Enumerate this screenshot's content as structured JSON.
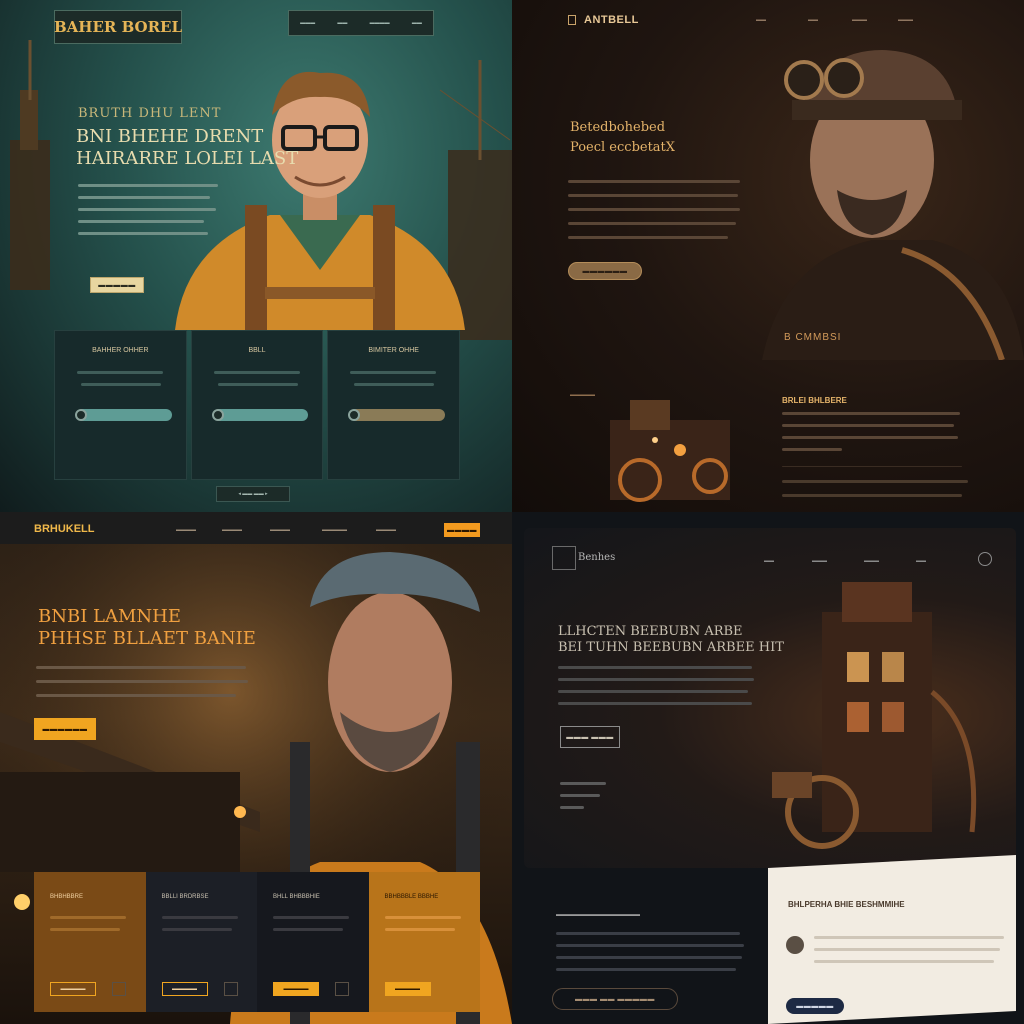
{
  "panel1": {
    "brand": "BAHER BOREL",
    "nav": [
      "▬▬▬",
      "▬▬",
      "▬▬▬▬",
      "▬▬"
    ],
    "kicker": "BRUTH DHU LENT",
    "headline": [
      "BNI BHEHE DRENT",
      "HAIRARRE LOLEI LAST"
    ],
    "cta_label": "▬▬▬▬▬",
    "cards": [
      {
        "title": "BAHHER OHHER"
      },
      {
        "title": "BBLL"
      },
      {
        "title": "BIMITER OHHE"
      }
    ],
    "pager_label": "◂ ▬▬ ▬▬ ▸",
    "colors": {
      "accent": "#e6b557",
      "teal_bar": "#5e9c95",
      "bronze_bar": "#8a7b57"
    }
  },
  "panel2": {
    "brand": "ANTBELL",
    "nav": [
      "▬▬",
      "▬▬",
      "▬▬▬",
      "▬▬▬"
    ],
    "headline": [
      "Betedbohebed",
      "Poecl eccbetatX"
    ],
    "cta_label": "▬▬▬▬▬▬",
    "side_label": "▬▬▬▬▬",
    "badge": "B CMMBSI",
    "section_title": "BRLEI BHLBERE",
    "colors": {
      "accent": "#e4b36a"
    }
  },
  "panel3": {
    "brand": "BRHUKELL",
    "nav": [
      "▬▬▬▬",
      "▬▬▬▬",
      "▬▬▬▬",
      "▬▬▬▬▬",
      "▬▬▬▬"
    ],
    "nav_button": "▬▬▬▬",
    "headline": [
      "BNBI LAMNHE",
      "PHHSE BLLAET BANIE"
    ],
    "cta_label": "▬▬▬▬▬▬",
    "cards": [
      {
        "title": "BHBHBBRE",
        "button": "▬▬▬▬▬"
      },
      {
        "title": "BBLLI BRDRBSE",
        "button": "▬▬▬▬▬"
      },
      {
        "title": "BHLL BHBBBHIE",
        "button": "▬▬▬▬▬"
      },
      {
        "title": "BBHBBBLE BBBHE",
        "button": "▬▬▬▬▬"
      }
    ],
    "colors": {
      "accent": "#f0a520"
    }
  },
  "panel4": {
    "brand": "Benhes",
    "nav": [
      "▬▬",
      "▬▬▬",
      "▬▬▬",
      "▬▬"
    ],
    "headline": [
      "LLHCTEN BEEBUBN ARBE",
      "BEI TUHN BEEBUBN ARBEE HIT"
    ],
    "cta_label": "▬▬▬ ▬▬▬",
    "sub_title": "▬▬▬▬▬▬▬▬▬▬▬▬▬▬",
    "light_title": "BHLPERHA BHIE BESHMMIHE",
    "light_button": "▬▬▬▬▬",
    "outline_button": "▬▬▬ ▬▬ ▬▬▬▬▬",
    "colors": {
      "light_card": "#f2ece2",
      "navy": "#1e2a44"
    }
  }
}
